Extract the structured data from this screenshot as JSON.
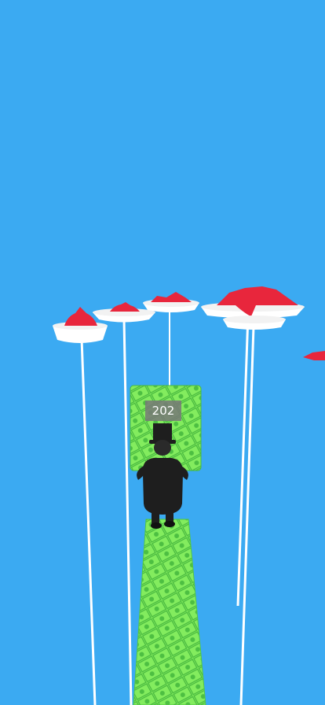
{
  "game": {
    "money_counter": "202"
  },
  "colors": {
    "sky": "#3BAAF2",
    "money_green": "#7CE65A",
    "money_dark": "#3FAE3A",
    "plate_white": "#FFFFFF",
    "jelly_red": "#E8263C",
    "character_black": "#1E1E1E"
  }
}
